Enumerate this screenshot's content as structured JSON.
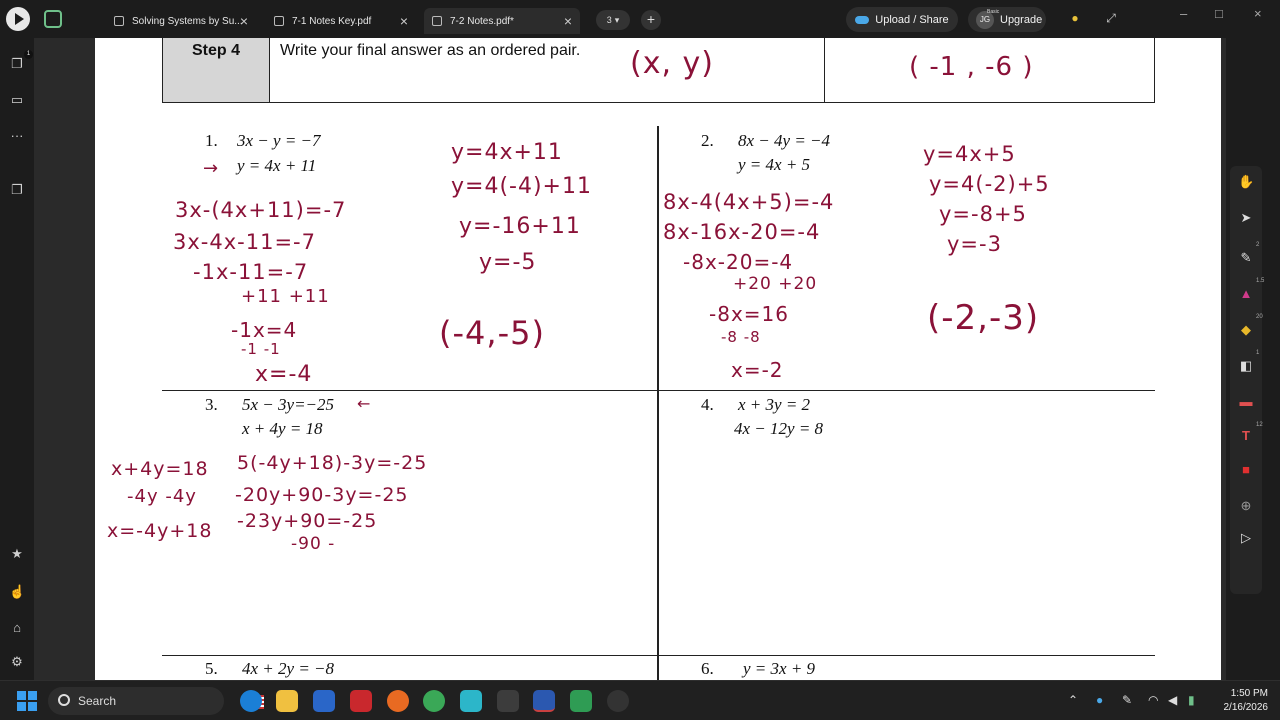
{
  "tabs": [
    {
      "label": "Solving Systems by Su...",
      "active": false
    },
    {
      "label": "7-1 Notes Key.pdf",
      "active": false
    },
    {
      "label": "7-2 Notes.pdf*",
      "active": true
    }
  ],
  "tab_count": "3",
  "header": {
    "upload_label": "Upload / Share",
    "avatar_initials": "JG",
    "plan_badge": "Basic",
    "upgrade_label": "Upgrade"
  },
  "step": {
    "label": "Step 4",
    "text": "Write your final answer as an ordered pair.",
    "handwritten_example": "(x, y)",
    "handwritten_answer": "( -1  , -6 )"
  },
  "problems": [
    {
      "num": "1.",
      "lines": [
        "3x − y = −7",
        "y = 4x + 11"
      ]
    },
    {
      "num": "2.",
      "lines": [
        "8x − 4y = −4",
        "y = 4x + 5"
      ]
    },
    {
      "num": "3.",
      "lines": [
        "5x − 3y=−25",
        "x + 4y = 18"
      ]
    },
    {
      "num": "4.",
      "lines": [
        "x + 3y = 2",
        "4x − 12y = 8"
      ]
    },
    {
      "num": "5.",
      "lines": [
        "4x + 2y = −8"
      ]
    },
    {
      "num": "6.",
      "lines": [
        "y = 3x + 9"
      ]
    }
  ],
  "handwriting": {
    "p1_left": [
      "3x-(4x+11)=-7",
      "3x-4x-11=-7",
      "-1x-11=-7",
      "+11  +11",
      "-1x=4",
      "-1   -1",
      "x=-4"
    ],
    "p1_right": [
      "y=4x+11",
      "y=4(-4)+11",
      "y=-16+11",
      "y=-5"
    ],
    "p1_answer": "(-4,-5)",
    "p2_left": [
      "8x-4(4x+5)=-4",
      "8x-16x-20=-4",
      "-8x-20=-4",
      "+20  +20",
      "-8x=16",
      "-8    -8",
      "x=-2"
    ],
    "p2_right": [
      "y=4x+5",
      "y=4(-2)+5",
      "y=-8+5",
      "y=-3"
    ],
    "p2_answer": "(-2,-3)",
    "p3_side": [
      "x+4y=18",
      "-4y  -4y",
      "x=-4y+18"
    ],
    "p3_work": [
      "5(-4y+18)-3y=-25",
      "-20y+90-3y=-25",
      "-23y+90=-25",
      "-90 -"
    ]
  },
  "right_tools": [
    {
      "icon": "hand-icon"
    },
    {
      "icon": "pointer-icon"
    },
    {
      "icon": "pen-icon",
      "num": "2"
    },
    {
      "icon": "marker-icon",
      "num": "1.5"
    },
    {
      "icon": "highlighter-icon",
      "num": "20"
    },
    {
      "icon": "eraser-icon",
      "num": "1"
    },
    {
      "icon": "shape-icon"
    },
    {
      "icon": "text-icon",
      "num": "12"
    },
    {
      "icon": "sticky-note-icon"
    },
    {
      "icon": "add-icon"
    },
    {
      "icon": "present-icon"
    }
  ],
  "taskbar": {
    "search_placeholder": "Search",
    "time": "1:50 PM",
    "date": "2/16/2026"
  },
  "colors": {
    "ink": "#8a1238",
    "accent_blue": "#3a9ff0"
  }
}
